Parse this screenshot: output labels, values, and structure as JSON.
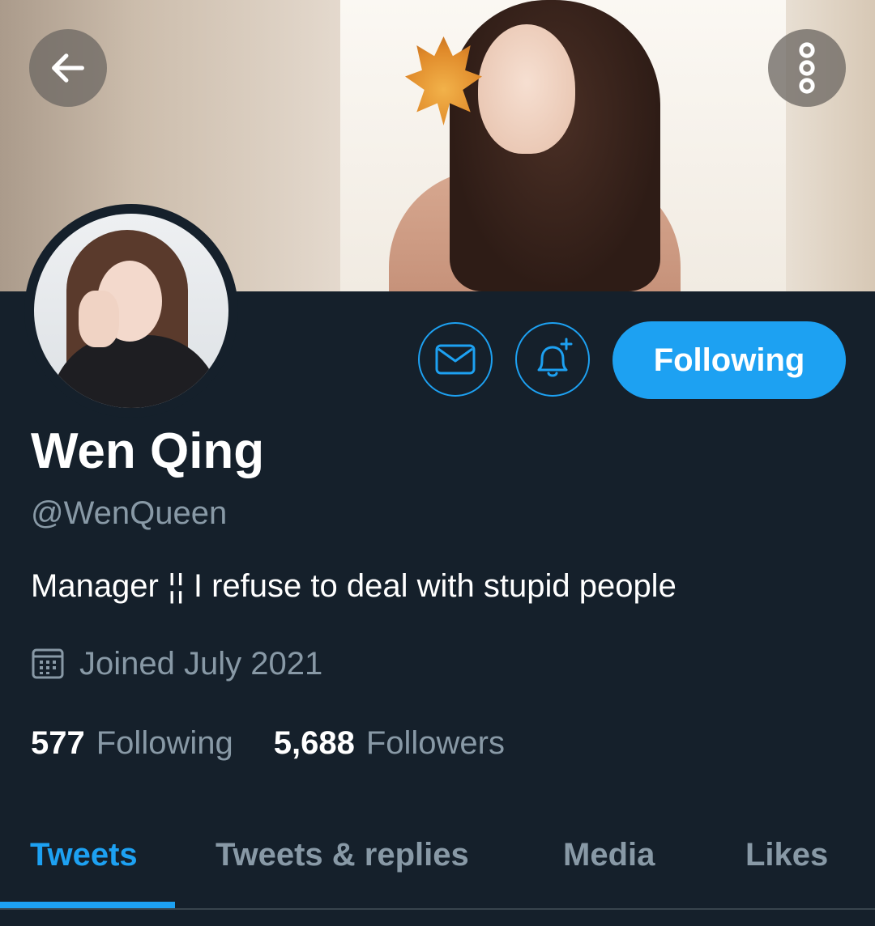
{
  "profile": {
    "name": "Wen Qing",
    "handle": "@WenQueen",
    "bio": "Manager ¦¦ I refuse to deal with stupid people",
    "joined": "Joined July 2021"
  },
  "actions": {
    "follow_label": "Following"
  },
  "stats": {
    "following_count": "577",
    "following_label": "Following",
    "followers_count": "5,688",
    "followers_label": "Followers"
  },
  "tabs": [
    {
      "label": "Tweets",
      "active": true
    },
    {
      "label": "Tweets & replies",
      "active": false
    },
    {
      "label": "Media",
      "active": false
    },
    {
      "label": "Likes",
      "active": false
    }
  ],
  "icons": {
    "back": "back-arrow-icon",
    "more": "more-vertical-icon",
    "message": "mail-icon",
    "notifications": "bell-plus-icon",
    "calendar": "calendar-icon"
  },
  "colors": {
    "background": "#15202b",
    "accent": "#1da1f2",
    "secondary_text": "#8899a6",
    "primary_text": "#ffffff"
  }
}
